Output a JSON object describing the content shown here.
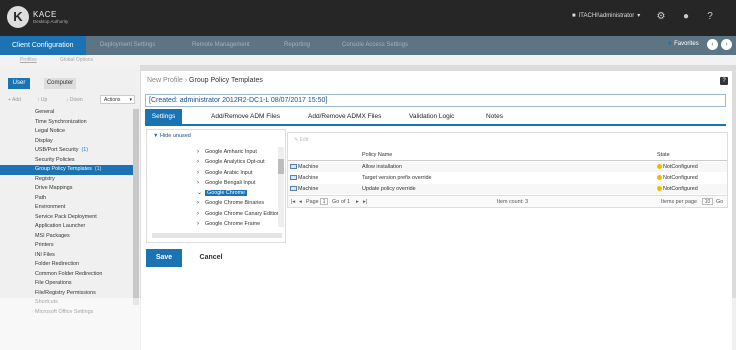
{
  "header": {
    "logo_letter": "K",
    "brand_name": "KACE",
    "brand_sub": "Desktop Authority",
    "user": "ITACHI\\administrator",
    "icons": [
      "person-icon",
      "gear-icon",
      "globe-icon",
      "help-icon"
    ]
  },
  "nav": {
    "active_tab": "Client Configuration",
    "tabs": [
      "Deployment Settings",
      "Remote Management",
      "Reporting",
      "Console Access Settings"
    ],
    "favorites": "Favorites"
  },
  "subnav": {
    "items": [
      "Profiles",
      "Global Options"
    ]
  },
  "sidebar": {
    "user_label": "User",
    "computer_label": "Computer",
    "add_label": "+ Add",
    "up_label": "↑ Up",
    "down_label": "↓ Down",
    "actions_label": "Actions",
    "items": [
      {
        "label": "General",
        "badge": ""
      },
      {
        "label": "Time Synchronization",
        "badge": ""
      },
      {
        "label": "Legal Notice",
        "badge": ""
      },
      {
        "label": "Display",
        "badge": ""
      },
      {
        "label": "USB/Port Security",
        "badge": "(1)"
      },
      {
        "label": "Security Policies",
        "badge": ""
      },
      {
        "label": "Group Policy Templates",
        "badge": "(1)"
      },
      {
        "label": "Registry",
        "badge": ""
      },
      {
        "label": "Drive Mappings",
        "badge": ""
      },
      {
        "label": "Path",
        "badge": ""
      },
      {
        "label": "Environment",
        "badge": ""
      },
      {
        "label": "Service Pack Deployment",
        "badge": ""
      },
      {
        "label": "Application Launcher",
        "badge": ""
      },
      {
        "label": "MSI Packages",
        "badge": ""
      },
      {
        "label": "Printers",
        "badge": ""
      },
      {
        "label": "INI Files",
        "badge": ""
      },
      {
        "label": "Folder Redirection",
        "badge": ""
      },
      {
        "label": "Common Folder Redirection",
        "badge": ""
      },
      {
        "label": "File Operations",
        "badge": ""
      },
      {
        "label": "File/Registry Permissions",
        "badge": ""
      },
      {
        "label": "Shortcuts",
        "badge": ""
      },
      {
        "label": "Microsoft Office Settings",
        "badge": ""
      }
    ],
    "selected_index": 6
  },
  "main": {
    "breadcrumb_parent": "New Profile",
    "breadcrumb_sep": "›",
    "breadcrumb_current": "Group Policy Templates",
    "help": "?",
    "created_text": "[Created: administrator 2012R2-DC1-L 08/07/2017 15:50]",
    "tabs": [
      "Settings",
      "Add/Remove ADM Files",
      "Add/Remove ADMX Files",
      "Validation Logic",
      "Notes"
    ],
    "hide_unused": "Hide unused",
    "tree": [
      {
        "label": "Google Amharic Input",
        "selected": false,
        "expanded": false
      },
      {
        "label": "Google Analytics Opt-out",
        "selected": false,
        "expanded": false
      },
      {
        "label": "Google Arabic Input",
        "selected": false,
        "expanded": false
      },
      {
        "label": "Google Bengali Input",
        "selected": false,
        "expanded": false
      },
      {
        "label": "Google Chrome",
        "selected": true,
        "expanded": true
      },
      {
        "label": "Google Chrome Binaries",
        "selected": false,
        "expanded": false
      },
      {
        "label": "Google Chrome Canary Edition",
        "selected": false,
        "expanded": false
      },
      {
        "label": "Google Chrome Frame",
        "selected": false,
        "expanded": false
      }
    ],
    "grid": {
      "edit_label": "Edit",
      "col_policy": "Policy Name",
      "col_state": "State",
      "rows": [
        {
          "type": "Machine",
          "policy": "Allow installation",
          "state": "NotConfigured"
        },
        {
          "type": "Machine",
          "policy": "Target version prefix override",
          "state": "NotConfigured"
        },
        {
          "type": "Machine",
          "policy": "Update policy override",
          "state": "NotConfigured"
        }
      ],
      "page_label": "Page",
      "page_value": "1",
      "page_of": "of 1",
      "go_label": "Go",
      "item_count": "Item count: 3",
      "per_page_label": "Items per page",
      "per_page_value": "10",
      "go2_label": "Go"
    },
    "save_label": "Save",
    "cancel_label": "Cancel"
  },
  "colors": {
    "accent": "#1b73b4",
    "topbar": "#262626",
    "tabbar": "#5d7483",
    "state_warning": "#f5b700"
  }
}
